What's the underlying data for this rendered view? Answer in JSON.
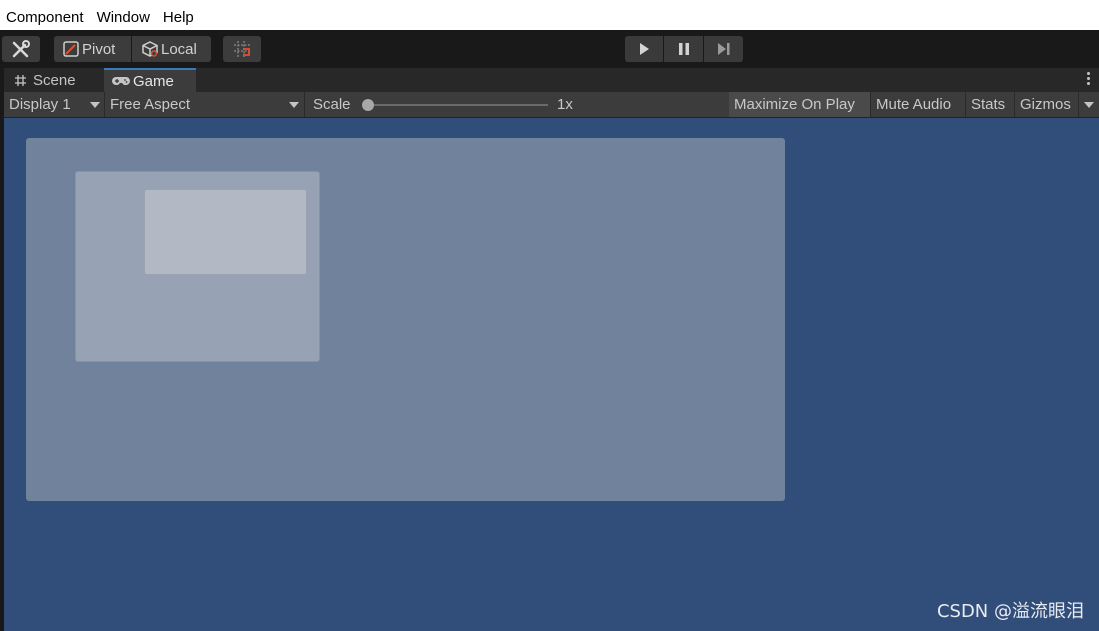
{
  "menu": [
    "Component",
    "Window",
    "Help"
  ],
  "toolbar": {
    "tools_icon": "tools-icon",
    "pivot_label": "Pivot",
    "local_label": "Local",
    "grid_snap_icon": "grid-snap-icon",
    "play_icon": "play-icon",
    "pause_icon": "pause-icon",
    "step_icon": "step-icon"
  },
  "tabs": {
    "scene": "Scene",
    "game": "Game"
  },
  "gamebar": {
    "display": "Display 1",
    "aspect": "Free Aspect",
    "scale_label": "Scale",
    "scale_value": "1x",
    "scale_fraction": 0.0,
    "maximize": "Maximize On Play",
    "mute": "Mute Audio",
    "stats": "Stats",
    "gizmos": "Gizmos"
  },
  "watermark": "CSDN @溢流眼泪",
  "colors": {
    "viewport_bg": "#314d79",
    "tab_active_border": "#3a79bb",
    "panel_outer": "#71829d",
    "panel_mid": "#97a3b5",
    "panel_inner": "#b2b9c4"
  }
}
